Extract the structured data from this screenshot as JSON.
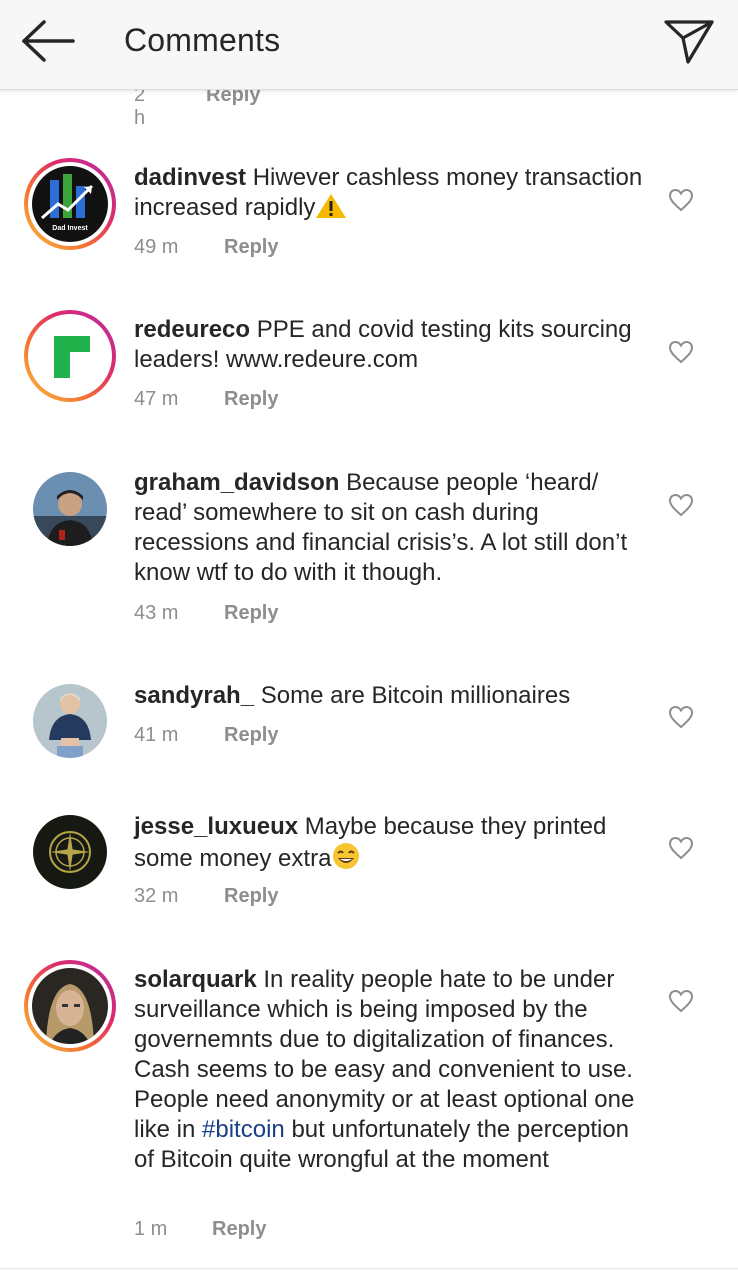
{
  "header": {
    "title": "Comments",
    "back_icon": "arrow-left-icon",
    "send_icon": "paper-plane-icon"
  },
  "partial_row": {
    "time": "2 h",
    "reply": "Reply"
  },
  "comments": [
    {
      "username": "dadinvest",
      "text": "Hiwever cashless money transaction increased rapidly",
      "emoji": "⚠️",
      "time": "49 m",
      "reply": "Reply",
      "has_story_ring": true,
      "avatar_text": "Dad Invest"
    },
    {
      "username": "redeureco",
      "text": "PPE and covid testing kits sourcing leaders! www.redeure.com",
      "time": "47 m",
      "reply": "Reply",
      "has_story_ring": true
    },
    {
      "username": "graham_davidson",
      "text": "Because people ‘heard/ read’ somewhere to sit on cash during recessions and financial crisis’s. A lot still don’t know wtf to do with it though.",
      "time": "43 m",
      "reply": "Reply",
      "has_story_ring": false
    },
    {
      "username": "sandyrah_",
      "text": "Some are Bitcoin millionaires",
      "time": "41 m",
      "reply": "Reply",
      "has_story_ring": false
    },
    {
      "username": "jesse_luxueux",
      "text": "Maybe because they printed some money extra",
      "emoji": "😂",
      "time": "32 m",
      "reply": "Reply",
      "has_story_ring": false
    },
    {
      "username": "solarquark",
      "text_before": "In reality people hate to be under surveillance which is being imposed by the governemnts due to digitalization of finances. Cash seems to be easy and convenient to use. People need anonymity or at least optional one like in",
      "hashtag": "#bitcoin",
      "text_after": "but unfortunately the perception of Bitcoin quite wrongful at the moment",
      "time": "1 m",
      "reply": "Reply",
      "has_story_ring": true
    }
  ],
  "colors": {
    "text": "#262626",
    "muted": "#8e8e8e",
    "hashtag": "#1b3f84",
    "header_bg": "#f7f7f7"
  }
}
